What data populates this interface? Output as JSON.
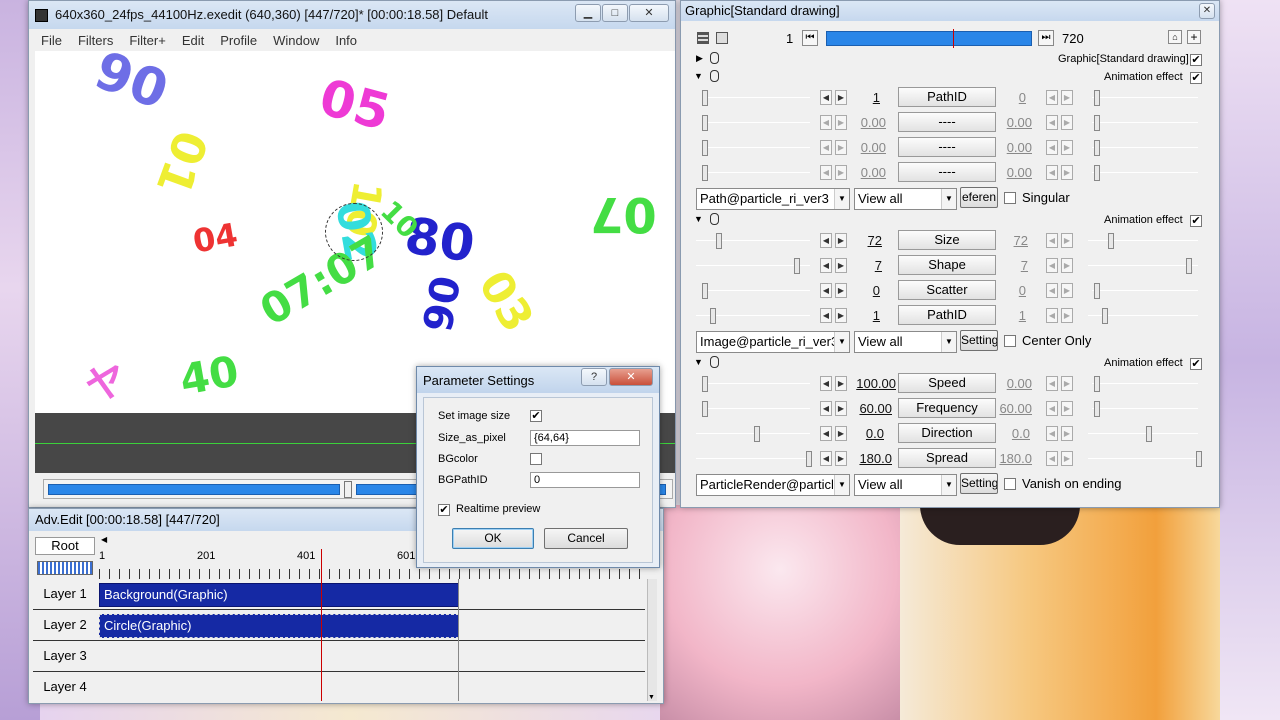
{
  "main_window": {
    "title": "640x360_24fps_44100Hz.exedit (640,360)  [447/720]* [00:00:18.58]  Default",
    "menu": [
      "File",
      "Filters",
      "Filter+",
      "Edit",
      "Profile",
      "Window",
      "Info"
    ],
    "controls": {
      "minimize": "▁",
      "maximize": "□",
      "close": "✕"
    }
  },
  "canvas_numbers": [
    {
      "text": "90",
      "color": "#6e6ee6"
    },
    {
      "text": "05",
      "color": "#ee3ad5"
    },
    {
      "text": "01",
      "color": "#eeee33"
    },
    {
      "text": "04",
      "color": "#ee3333"
    },
    {
      "text": "10",
      "color": "#eeee33"
    },
    {
      "text": "02",
      "color": "#33dddd"
    },
    {
      "text": "80",
      "color": "#2222cc"
    },
    {
      "text": "07",
      "color": "#44dd44"
    },
    {
      "text": "07:07",
      "color": "#44dd44"
    },
    {
      "text": "03",
      "color": "#eeee33"
    },
    {
      "text": "90",
      "color": "#2222cc"
    },
    {
      "text": "10",
      "color": "#44dd44"
    },
    {
      "text": "40",
      "color": "#44dd44"
    },
    {
      "text": "ヤ",
      "color": "#ee66dd"
    }
  ],
  "adv_edit": {
    "title": "Adv.Edit [00:00:18.58] [447/720]",
    "root_label": "Root",
    "ruler": [
      "1",
      "201",
      "401",
      "601"
    ],
    "layers": [
      {
        "label": "Layer 1",
        "clip": "Background(Graphic)"
      },
      {
        "label": "Layer 2",
        "clip": "Circle(Graphic)"
      },
      {
        "label": "Layer 3",
        "clip": ""
      },
      {
        "label": "Layer 4",
        "clip": ""
      }
    ]
  },
  "graphic_panel": {
    "title": "Graphic[Standard drawing]",
    "frame_start": "1",
    "frame_end": "720",
    "header_check_label": "Graphic[Standard drawing]",
    "anim_label": "Animation effect",
    "section1": {
      "rows": [
        {
          "left": "1",
          "label": "PathID",
          "right": "0",
          "left_dim": false,
          "right_dim": true
        },
        {
          "left": "0.00",
          "label": "----",
          "right": "0.00",
          "left_dim": true,
          "right_dim": true
        },
        {
          "left": "0.00",
          "label": "----",
          "right": "0.00",
          "left_dim": true,
          "right_dim": true
        },
        {
          "left": "0.00",
          "label": "----",
          "right": "0.00",
          "left_dim": true,
          "right_dim": true
        }
      ],
      "select1": "Path@particle_ri_ver3",
      "select2": "View all",
      "btn": "eferen",
      "check": "Singular"
    },
    "section2": {
      "rows": [
        {
          "left": "72",
          "label": "Size",
          "right": "72"
        },
        {
          "left": "7",
          "label": "Shape",
          "right": "7"
        },
        {
          "left": "0",
          "label": "Scatter",
          "right": "0"
        },
        {
          "left": "1",
          "label": "PathID",
          "right": "1"
        }
      ],
      "select1": "Image@particle_ri_ver3",
      "select2": "View all",
      "btn": "Setting",
      "check": "Center Only"
    },
    "section3": {
      "rows": [
        {
          "left": "100.00",
          "label": "Speed",
          "right": "0.00"
        },
        {
          "left": "60.00",
          "label": "Frequency",
          "right": "60.00"
        },
        {
          "left": "0.0",
          "label": "Direction",
          "right": "0.0"
        },
        {
          "left": "180.0",
          "label": "Spread",
          "right": "180.0"
        }
      ],
      "select1": "ParticleRender@particle",
      "select2": "View all",
      "btn": "Setting",
      "check": "Vanish on ending"
    }
  },
  "dialog": {
    "title": "Parameter Settings",
    "help": "?",
    "close": "✕",
    "fields": [
      {
        "label": "Set image size",
        "type": "check",
        "checked": "✔"
      },
      {
        "label": "Size_as_pixel",
        "type": "text",
        "value": "{64,64}"
      },
      {
        "label": "BGcolor",
        "type": "check",
        "checked": ""
      },
      {
        "label": "BGPathID",
        "type": "text",
        "value": "0"
      }
    ],
    "realtime": "Realtime preview",
    "realtime_checked": "✔",
    "ok": "OK",
    "cancel": "Cancel"
  }
}
